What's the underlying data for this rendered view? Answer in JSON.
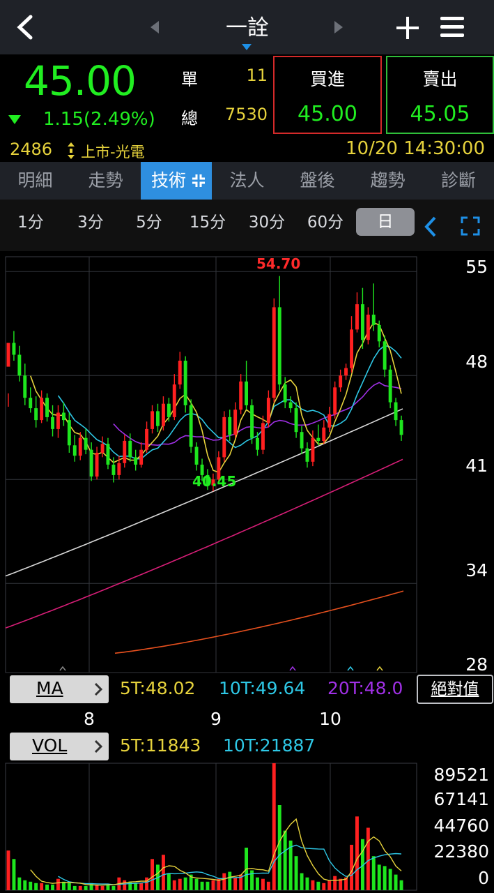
{
  "header": {
    "title": "一詮"
  },
  "quote": {
    "price": "45.00",
    "change": "1.15(2.49%)",
    "single_label": "單",
    "single_value": "11",
    "total_label": "總",
    "total_value": "7530",
    "buy_label": "買進",
    "buy_price": "45.00",
    "sell_label": "賣出",
    "sell_price": "45.05",
    "code": "2486",
    "market": "上市-光電",
    "datetime": "10/20 14:30:00"
  },
  "tabs": [
    "明細",
    "走勢",
    "技術",
    "法人",
    "盤後",
    "趨勢",
    "診斷"
  ],
  "active_tab": "技術",
  "periods": [
    "1分",
    "3分",
    "5分",
    "15分",
    "30分",
    "60分",
    "日"
  ],
  "active_period": "日",
  "price_chart": {
    "high_label": "54.70",
    "low_label": "40.45",
    "y_ticks": [
      "55",
      "48",
      "41",
      "34",
      "28"
    ],
    "x_ticks": [
      "8",
      "9",
      "10"
    ],
    "ma_button": "MA",
    "ma5": "5T:48.02",
    "ma10": "10T:49.64",
    "ma20": "20T:48.0",
    "abs_button": "絕對值"
  },
  "volume_chart": {
    "vol_button": "VOL",
    "v5": "5T:11843",
    "v10": "10T:21887",
    "y_ticks": [
      "89521",
      "67141",
      "44760",
      "22380",
      "0"
    ]
  },
  "colors": {
    "up": "#ff2020",
    "down": "#1ee61e",
    "ma5": "#e6d23c",
    "ma10": "#2ec8e6",
    "ma20": "#a030e6",
    "ma60": "#d8d8d8",
    "ma120": "#d81e78",
    "ma240": "#e6501e"
  },
  "chart_data": [
    {
      "type": "candlestick",
      "title": "",
      "x_ticks": [
        "8",
        "9",
        "10"
      ],
      "ylim": [
        28,
        56
      ],
      "y_ticks": [
        55,
        48,
        41,
        34,
        28
      ],
      "annotations": [
        {
          "text": "54.70",
          "kind": "high"
        },
        {
          "text": "40.45",
          "kind": "low"
        }
      ],
      "candles": [
        [
          48.6,
          50.2,
          46.8,
          45.9
        ],
        [
          50.2,
          49.4,
          51.0,
          49.0
        ],
        [
          49.4,
          48.0,
          50.0,
          47.6
        ],
        [
          48.0,
          46.5,
          48.8,
          46.0
        ],
        [
          46.5,
          45.8,
          47.2,
          45.5
        ],
        [
          45.8,
          45.0,
          46.6,
          44.5
        ],
        [
          45.0,
          46.5,
          47.0,
          44.8
        ],
        [
          46.5,
          45.2,
          46.8,
          44.9
        ],
        [
          45.2,
          44.4,
          46.0,
          43.9
        ],
        [
          44.4,
          45.5,
          46.0,
          43.8
        ],
        [
          45.5,
          45.0,
          46.2,
          44.6
        ],
        [
          45.0,
          43.3,
          45.5,
          42.8
        ],
        [
          43.3,
          42.6,
          44.0,
          42.2
        ],
        [
          42.6,
          43.8,
          44.2,
          42.3
        ],
        [
          43.8,
          43.0,
          44.4,
          42.7
        ],
        [
          43.0,
          41.2,
          43.5,
          40.9
        ],
        [
          41.2,
          42.8,
          43.2,
          41.0
        ],
        [
          42.8,
          43.4,
          43.9,
          42.5
        ],
        [
          43.4,
          42.0,
          43.8,
          41.7
        ],
        [
          42.0,
          41.3,
          42.5,
          40.8
        ],
        [
          41.3,
          42.1,
          42.6,
          41.0
        ],
        [
          42.1,
          43.6,
          44.0,
          41.8
        ],
        [
          43.6,
          42.5,
          44.1,
          42.2
        ],
        [
          42.5,
          42.0,
          43.0,
          41.6
        ],
        [
          42.0,
          43.0,
          43.5,
          41.8
        ],
        [
          43.0,
          44.4,
          44.9,
          42.8
        ],
        [
          44.4,
          45.6,
          46.0,
          44.1
        ],
        [
          45.6,
          44.6,
          46.1,
          44.2
        ],
        [
          44.6,
          46.1,
          46.6,
          44.3
        ],
        [
          46.1,
          45.2,
          46.5,
          44.9
        ],
        [
          45.2,
          47.4,
          48.1,
          45.0
        ],
        [
          47.4,
          49.0,
          49.6,
          47.1
        ],
        [
          49.0,
          46.0,
          49.3,
          45.5
        ],
        [
          46.0,
          43.2,
          46.4,
          42.8
        ],
        [
          43.2,
          42.0,
          43.5,
          41.6
        ],
        [
          42.0,
          41.3,
          42.4,
          40.9
        ],
        [
          41.3,
          40.6,
          41.7,
          40.3
        ],
        [
          40.6,
          41.0,
          41.4,
          40.2
        ],
        [
          41.0,
          42.5,
          42.9,
          40.7
        ],
        [
          42.5,
          45.2,
          45.6,
          42.2
        ],
        [
          45.2,
          44.0,
          45.7,
          43.6
        ],
        [
          44.0,
          45.7,
          46.2,
          43.8
        ],
        [
          45.7,
          47.6,
          48.1,
          45.4
        ],
        [
          47.6,
          46.0,
          49.0,
          45.7
        ],
        [
          46.0,
          43.8,
          46.4,
          43.4
        ],
        [
          43.8,
          43.0,
          44.2,
          42.6
        ],
        [
          43.0,
          44.8,
          45.3,
          42.7
        ],
        [
          44.8,
          46.5,
          47.0,
          44.5
        ],
        [
          46.5,
          52.6,
          53.2,
          46.2
        ],
        [
          52.6,
          47.4,
          54.7,
          47.0
        ],
        [
          47.4,
          46.2,
          47.9,
          45.8
        ],
        [
          46.2,
          45.8,
          46.6,
          45.5
        ],
        [
          45.8,
          44.2,
          46.2,
          43.8
        ],
        [
          44.2,
          43.1,
          44.6,
          42.7
        ],
        [
          43.1,
          42.2,
          43.5,
          41.8
        ],
        [
          42.2,
          43.8,
          44.3,
          41.9
        ],
        [
          43.8,
          43.6,
          44.7,
          43.3
        ],
        [
          43.6,
          44.5,
          45.0,
          43.4
        ],
        [
          44.5,
          45.4,
          45.9,
          44.2
        ],
        [
          45.4,
          47.2,
          47.6,
          45.1
        ],
        [
          47.2,
          48.0,
          48.4,
          46.9
        ],
        [
          48.0,
          48.5,
          48.8,
          47.7
        ],
        [
          48.5,
          51.1,
          52.0,
          48.2
        ],
        [
          51.1,
          52.8,
          53.6,
          50.9
        ],
        [
          52.8,
          50.4,
          53.9,
          49.8
        ],
        [
          50.4,
          52.1,
          52.6,
          50.1
        ],
        [
          52.1,
          51.4,
          54.2,
          51.0
        ],
        [
          51.4,
          50.3,
          51.7,
          49.9
        ],
        [
          50.3,
          48.4,
          50.7,
          47.9
        ],
        [
          48.4,
          46.2,
          48.7,
          45.8
        ],
        [
          46.2,
          45.0,
          46.5,
          44.6
        ],
        [
          45.0,
          44.0,
          45.3,
          43.6
        ]
      ],
      "series": [
        {
          "name": "MA",
          "values": [
            48.02,
            49.64,
            48.0
          ]
        }
      ]
    },
    {
      "type": "bar",
      "title": "",
      "ylim": [
        0,
        89521
      ],
      "y_ticks": [
        0,
        22380,
        44760,
        67141,
        89521
      ],
      "values": [
        28000,
        22000,
        9000,
        7000,
        6000,
        5000,
        5000,
        4000,
        4000,
        8000,
        6000,
        5000,
        3000,
        3000,
        3000,
        5000,
        4000,
        3000,
        4000,
        3000,
        9000,
        7000,
        6000,
        5000,
        5000,
        9000,
        22000,
        18000,
        25000,
        12000,
        7000,
        8000,
        9000,
        11000,
        8000,
        6000,
        6000,
        7000,
        8000,
        12000,
        13000,
        9000,
        11000,
        30000,
        14000,
        9000,
        8000,
        6000,
        89521,
        60000,
        42000,
        35000,
        24000,
        12000,
        9000,
        7000,
        6000,
        5000,
        7000,
        10000,
        8000,
        9000,
        32000,
        52000,
        36000,
        44000,
        24000,
        18000,
        17000,
        15000,
        11000,
        7000
      ]
    }
  ]
}
